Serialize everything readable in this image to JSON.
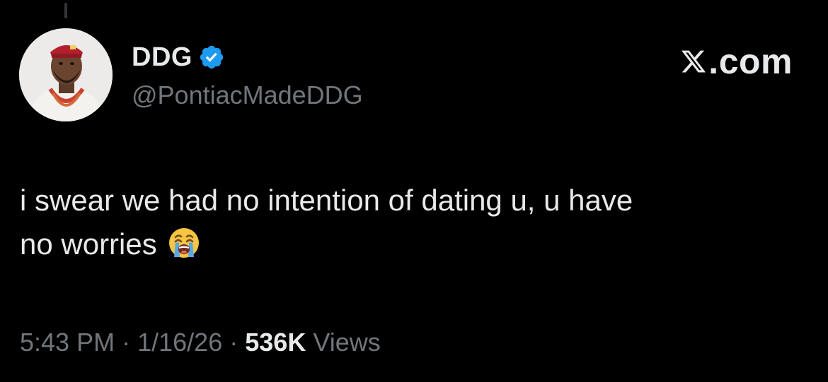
{
  "user": {
    "display_name": "DDG",
    "handle": "@PontiacMadeDDG",
    "verified_icon": "verified-badge-icon"
  },
  "brand": {
    "icon": "x-logo-icon",
    "text": ".com"
  },
  "tweet": {
    "line1": "i swear we had no intention of dating u, u have",
    "line2": "no worries",
    "emoji_icon": "loudly-crying-face-icon"
  },
  "meta": {
    "time": "5:43 PM",
    "sep1": "·",
    "date": "1/16/26",
    "sep2": "·",
    "views_count": "536K",
    "views_label": "Views"
  },
  "colors": {
    "background": "#000000",
    "primary_text": "#e7e9ea",
    "secondary_text": "#71767b",
    "verified_blue": "#1d9bf0"
  }
}
